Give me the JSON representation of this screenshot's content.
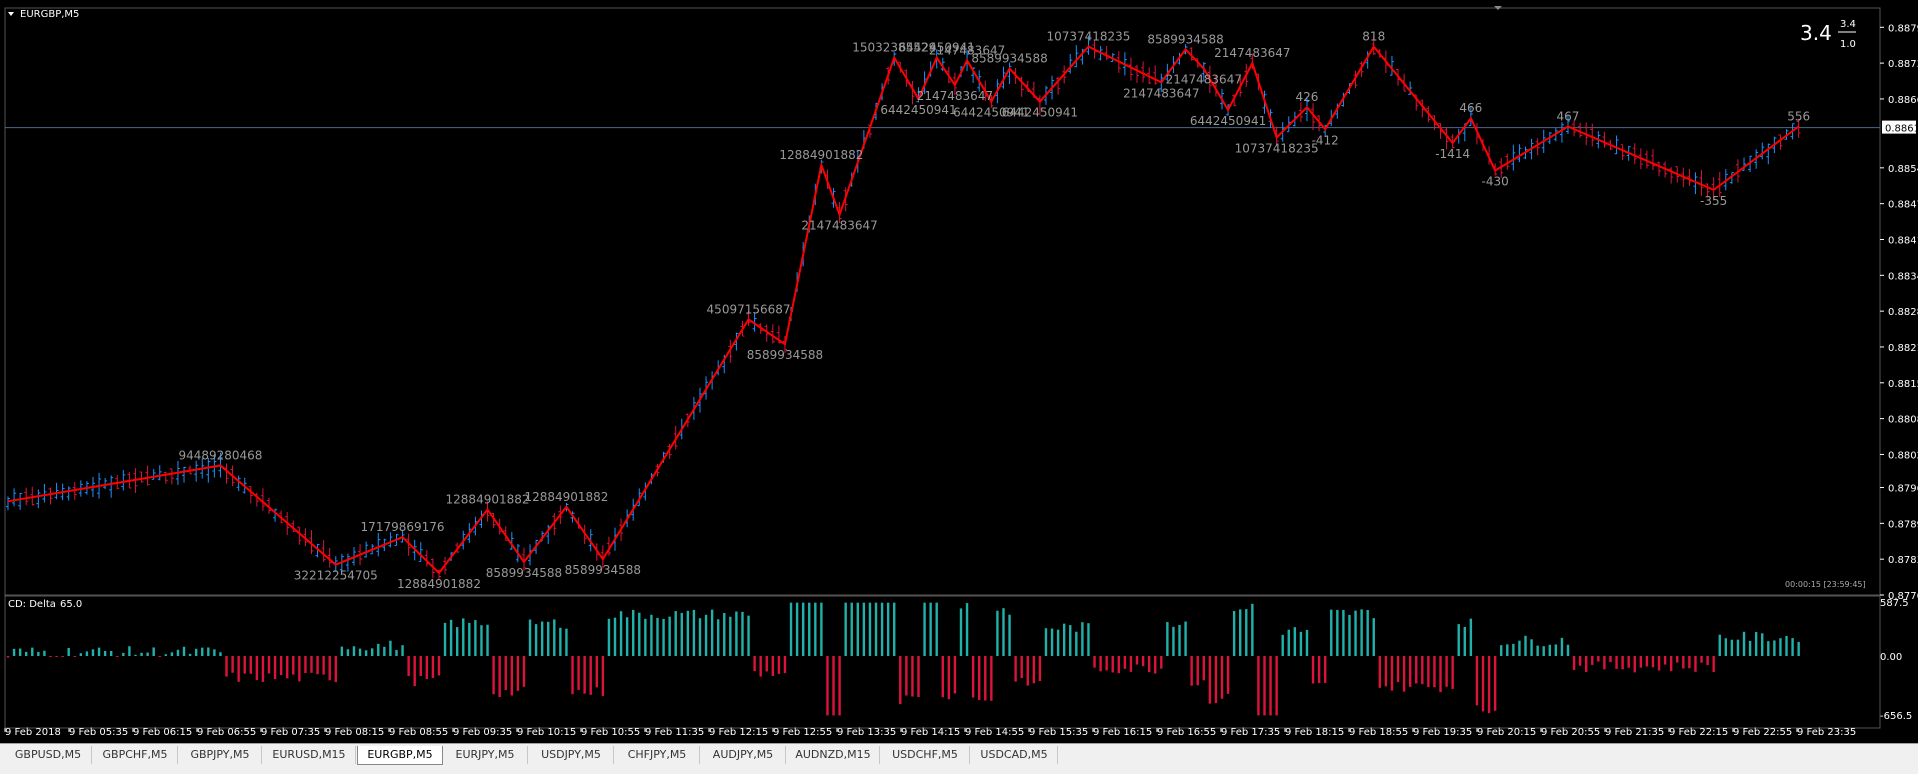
{
  "window": {
    "symbol_title": "EURGBP,M5"
  },
  "indicator": {
    "title": "CD: Delta",
    "value": "65.0",
    "ymax_label": "587.5",
    "yzero_label": "0.00",
    "ymin_label": "-656.5"
  },
  "corner": {
    "big": "3.4",
    "top": "3.4",
    "bottom": "1.0"
  },
  "timer": "00:00:15 [23:59:45]",
  "colors": {
    "bg": "#000000",
    "bull": "#1e90ff",
    "bear": "#dc143c",
    "zigzag": "#ff0000",
    "hist_pos": "#20b2aa",
    "hist_neg": "#dc143c",
    "label": "#999999",
    "axis": "#ffffff",
    "current_line": "#4a6a8a"
  },
  "chart_data": {
    "type": "line",
    "title": "EURGBP,M5",
    "series": [
      {
        "values_desc": "zigzag"
      }
    ],
    "price_axis": [
      "0.88795",
      "0.88730",
      "0.88665",
      "0.88540",
      "0.88475",
      "0.88410",
      "0.88345",
      "0.88280",
      "0.88215",
      "0.88150",
      "0.88085",
      "0.88020",
      "0.87960",
      "0.87895",
      "0.87830",
      "0.87765"
    ],
    "current_price": "0.88613",
    "ylim": [
      0.87765,
      0.8883
    ],
    "time_axis": [
      "9 Feb 2018",
      "9 Feb 05:35",
      "9 Feb 06:15",
      "9 Feb 06:55",
      "9 Feb 07:35",
      "9 Feb 08:15",
      "9 Feb 08:55",
      "9 Feb 09:35",
      "9 Feb 10:15",
      "9 Feb 10:55",
      "9 Feb 11:35",
      "9 Feb 12:15",
      "9 Feb 12:55",
      "9 Feb 13:35",
      "9 Feb 14:15",
      "9 Feb 14:55",
      "9 Feb 15:35",
      "9 Feb 16:15",
      "9 Feb 16:55",
      "9 Feb 17:35",
      "9 Feb 18:15",
      "9 Feb 18:55",
      "9 Feb 19:35",
      "9 Feb 20:15",
      "9 Feb 20:55",
      "9 Feb 21:35",
      "9 Feb 22:15",
      "9 Feb 22:55",
      "9 Feb 23:35"
    ],
    "zigzag": [
      {
        "i": 0,
        "p": 0.87935
      },
      {
        "i": 35,
        "p": 0.88,
        "label": "94489280468"
      },
      {
        "i": 54,
        "p": 0.8782,
        "label": "32212254705"
      },
      {
        "i": 65,
        "p": 0.8787,
        "label": "17179869176"
      },
      {
        "i": 71,
        "p": 0.87805,
        "label": "12884901882"
      },
      {
        "i": 79,
        "p": 0.8792,
        "label": "12884901882"
      },
      {
        "i": 85,
        "p": 0.87825,
        "label": "8589934588"
      },
      {
        "i": 92,
        "p": 0.87925,
        "label": "12884901882"
      },
      {
        "i": 98,
        "p": 0.8783,
        "label": "8589934588"
      },
      {
        "i": 122,
        "p": 0.88265,
        "label": "45097156687"
      },
      {
        "i": 128,
        "p": 0.8822,
        "label": "8589934588"
      },
      {
        "i": 134,
        "p": 0.88545,
        "label": "12884901882"
      },
      {
        "i": 137,
        "p": 0.88455,
        "label": "2147483647"
      },
      {
        "i": 146,
        "p": 0.8874,
        "label": "15032385529"
      },
      {
        "i": 150,
        "p": 0.88665,
        "label": "6442450941"
      },
      {
        "i": 153,
        "p": 0.8874,
        "label": "6442450941"
      },
      {
        "i": 156,
        "p": 0.8869,
        "label": "2147483647"
      },
      {
        "i": 158,
        "p": 0.88735,
        "label": "2147483647"
      },
      {
        "i": 162,
        "p": 0.8866,
        "label": "6442450941"
      },
      {
        "i": 165,
        "p": 0.8872,
        "label": "8589934588"
      },
      {
        "i": 170,
        "p": 0.8866,
        "label": "6442450941"
      },
      {
        "i": 178,
        "p": 0.8876,
        "label": "10737418235"
      },
      {
        "i": 190,
        "p": 0.88695,
        "label": "2147483647"
      },
      {
        "i": 194,
        "p": 0.88755,
        "label": "8589934588"
      },
      {
        "i": 197,
        "p": 0.8872,
        "label": "2147483647"
      },
      {
        "i": 201,
        "p": 0.88645,
        "label": "6442450941"
      },
      {
        "i": 205,
        "p": 0.8873,
        "label": "2147483647"
      },
      {
        "i": 209,
        "p": 0.88595,
        "label": "10737418235"
      },
      {
        "i": 214,
        "p": 0.8865,
        "label": "426"
      },
      {
        "i": 217,
        "p": 0.8861,
        "label": "-412"
      },
      {
        "i": 225,
        "p": 0.8876,
        "label": "818"
      },
      {
        "i": 238,
        "p": 0.88585,
        "label": "-1414"
      },
      {
        "i": 241,
        "p": 0.8863,
        "label": "466"
      },
      {
        "i": 245,
        "p": 0.88535,
        "label": "-430"
      },
      {
        "i": 257,
        "p": 0.88615,
        "label": "467"
      },
      {
        "i": 281,
        "p": 0.885,
        "label": "-355"
      },
      {
        "i": 295,
        "p": 0.88615,
        "label": "556"
      }
    ]
  },
  "tabs": [
    "GBPUSD,M5",
    "GBPCHF,M5",
    "GBPJPY,M5",
    "EURUSD,M15",
    "EURGBP,M5",
    "EURJPY,M5",
    "USDJPY,M5",
    "CHFJPY,M5",
    "AUDJPY,M5",
    "AUDNZD,M15",
    "USDCHF,M5",
    "USDCAD,M5"
  ],
  "active_tab": "EURGBP,M5"
}
